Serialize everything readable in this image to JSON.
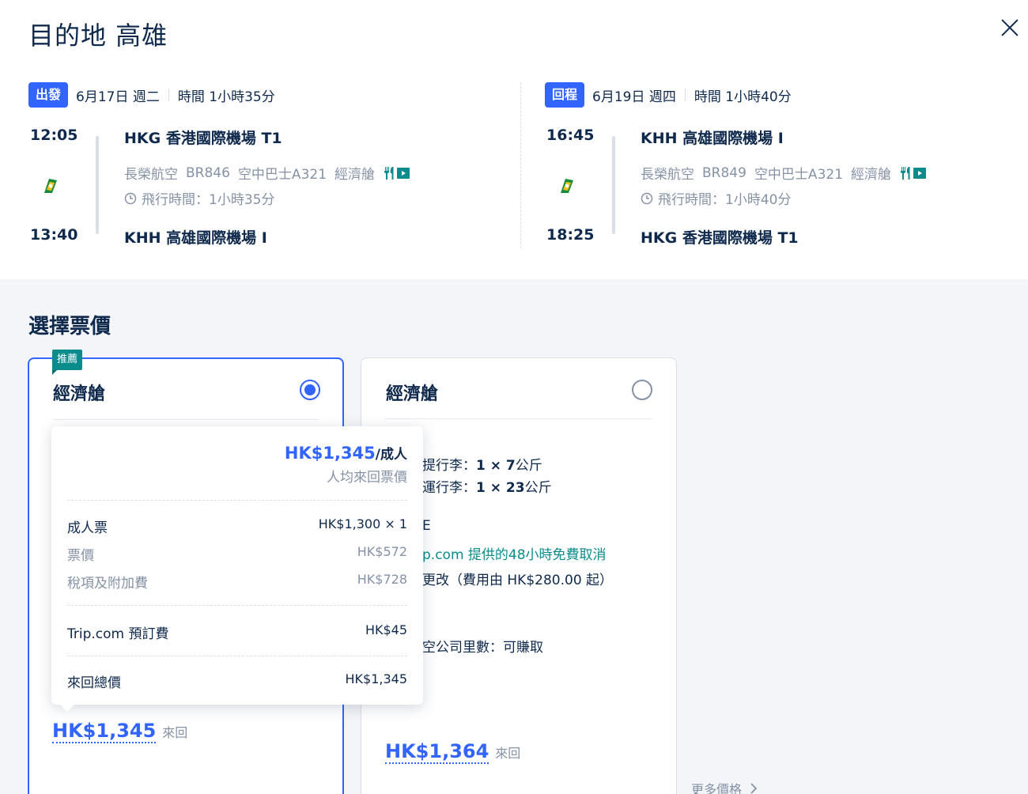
{
  "header": {
    "title": "目的地 高雄"
  },
  "outbound": {
    "tag": "出發",
    "date": "6月17日 週二",
    "duration_head": "時間 1小時35分",
    "dep_time": "12:05",
    "arr_time": "13:40",
    "dep_airport": "HKG 香港國際機場 T1",
    "arr_airport": "KHH 高雄國際機場 I",
    "airline": "長榮航空",
    "flight_no": "BR846",
    "aircraft": "空中巴士A321",
    "cabin": "經濟艙",
    "flight_duration": "飛行時間：1小時35分"
  },
  "return": {
    "tag": "回程",
    "date": "6月19日 週四",
    "duration_head": "時間 1小時40分",
    "dep_time": "16:45",
    "arr_time": "18:25",
    "dep_airport": "KHH 高雄國際機場 I",
    "arr_airport": "HKG 香港國際機場 T1",
    "airline": "長榮航空",
    "flight_no": "BR849",
    "aircraft": "空中巴士A321",
    "cabin": "經濟艙",
    "flight_duration": "飛行時間：1小時40分"
  },
  "fares": {
    "section_title": "選擇票價",
    "card1": {
      "badge": "推薦",
      "name": "經濟艙",
      "price": "HK$1,345",
      "suffix": "來回",
      "selected": true
    },
    "card2": {
      "name": "經濟艙",
      "price": "HK$1,364",
      "suffix": "來回",
      "selected": false,
      "carry_on_label": "提行李：",
      "carry_on_value": "1 × 7",
      "carry_on_unit": "公斤",
      "checked_label": "運行李：",
      "checked_value": "1 × 23",
      "checked_unit": "公斤",
      "policy_fragment": "E",
      "free_cancel": "p.com 提供的48小時免費取消",
      "change_fee": "更改（費用由 HK$280.00 起）",
      "miles": "空公司里數：可賺取"
    },
    "more_prices": "更多價格"
  },
  "price_popup": {
    "price": "HK$1,345",
    "per": "/成人",
    "sub": "人均來回票價",
    "rows": [
      {
        "label": "成人票",
        "value": "HK$1,300 × 1"
      },
      {
        "label": "票價",
        "value": "HK$572"
      },
      {
        "label": "稅項及附加費",
        "value": "HK$728"
      },
      {
        "label": "Trip.com 預訂費",
        "value": "HK$45"
      },
      {
        "label": "來回總價",
        "value": "HK$1,345"
      }
    ]
  },
  "colors": {
    "accent": "#3264ff",
    "teal": "#0a8c8c",
    "text": "#0f294d",
    "muted": "#8592a6"
  },
  "icons": {
    "close": "close-icon",
    "airline_logo": "eva-air-logo-icon",
    "meal": "meal-icon",
    "entertainment": "tv-icon",
    "clock": "clock-icon",
    "chevron": "chevron-right-icon"
  }
}
